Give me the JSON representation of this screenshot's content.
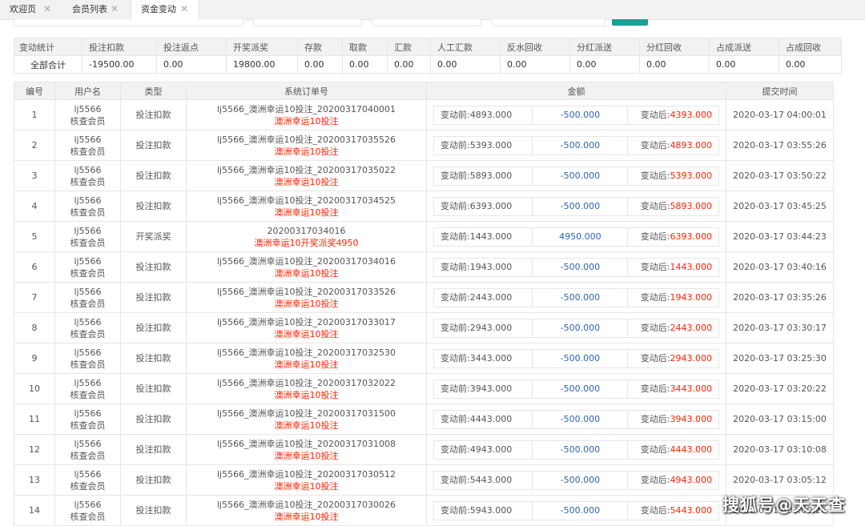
{
  "tabs": [
    {
      "label": "欢迎页",
      "active": false
    },
    {
      "label": "会员列表",
      "active": false
    },
    {
      "label": "资金变动",
      "active": true
    }
  ],
  "stats": {
    "headers": [
      "变动统计",
      "投注扣款",
      "投注返点",
      "开奖派奖",
      "存款",
      "取款",
      "汇款",
      "人工汇款",
      "反水回收",
      "分红派送",
      "分红回收",
      "占成派送",
      "占成回收"
    ],
    "values": [
      "全部合计",
      "-19500.00",
      "0.00",
      "19800.00",
      "0.00",
      "0.00",
      "0.00",
      "0.00",
      "0.00",
      "0.00",
      "0.00",
      "0.00",
      "0.00"
    ]
  },
  "table": {
    "headers": {
      "index": "编号",
      "username": "用户名",
      "type": "类型",
      "order": "系统订单号",
      "amount": "金额",
      "time": "提交时间"
    },
    "before_label": "变动前:",
    "after_label": "变动后:",
    "rows": [
      {
        "index": "1",
        "user": "lj5566",
        "role": "核查会员",
        "type": "投注扣款",
        "order": "lj5566_澳洲幸运10投注_20200317040001",
        "desc": "澳洲幸运10投注",
        "before": "4893.000",
        "change": "-500.000",
        "after": "4393.000",
        "time": "2020-03-17 04:00:01"
      },
      {
        "index": "2",
        "user": "lj5566",
        "role": "核查会员",
        "type": "投注扣款",
        "order": "lj5566_澳洲幸运10投注_20200317035526",
        "desc": "澳洲幸运10投注",
        "before": "5393.000",
        "change": "-500.000",
        "after": "4893.000",
        "time": "2020-03-17 03:55:26"
      },
      {
        "index": "3",
        "user": "lj5566",
        "role": "核查会员",
        "type": "投注扣款",
        "order": "lj5566_澳洲幸运10投注_20200317035022",
        "desc": "澳洲幸运10投注",
        "before": "5893.000",
        "change": "-500.000",
        "after": "5393.000",
        "time": "2020-03-17 03:50:22"
      },
      {
        "index": "4",
        "user": "lj5566",
        "role": "核查会员",
        "type": "投注扣款",
        "order": "lj5566_澳洲幸运10投注_20200317034525",
        "desc": "澳洲幸运10投注",
        "before": "6393.000",
        "change": "-500.000",
        "after": "5893.000",
        "time": "2020-03-17 03:45:25"
      },
      {
        "index": "5",
        "user": "lj5566",
        "role": "核查会员",
        "type": "开奖派奖",
        "order": "20200317034016",
        "desc": "澳洲幸运10开奖派奖4950",
        "before": "1443.000",
        "change": "4950.000",
        "after": "6393.000",
        "time": "2020-03-17 03:44:23"
      },
      {
        "index": "6",
        "user": "lj5566",
        "role": "核查会员",
        "type": "投注扣款",
        "order": "lj5566_澳洲幸运10投注_20200317034016",
        "desc": "澳洲幸运10投注",
        "before": "1943.000",
        "change": "-500.000",
        "after": "1443.000",
        "time": "2020-03-17 03:40:16"
      },
      {
        "index": "7",
        "user": "lj5566",
        "role": "核查会员",
        "type": "投注扣款",
        "order": "lj5566_澳洲幸运10投注_20200317033526",
        "desc": "澳洲幸运10投注",
        "before": "2443.000",
        "change": "-500.000",
        "after": "1943.000",
        "time": "2020-03-17 03:35:26"
      },
      {
        "index": "8",
        "user": "lj5566",
        "role": "核查会员",
        "type": "投注扣款",
        "order": "lj5566_澳洲幸运10投注_20200317033017",
        "desc": "澳洲幸运10投注",
        "before": "2943.000",
        "change": "-500.000",
        "after": "2443.000",
        "time": "2020-03-17 03:30:17"
      },
      {
        "index": "9",
        "user": "lj5566",
        "role": "核查会员",
        "type": "投注扣款",
        "order": "lj5566_澳洲幸运10投注_20200317032530",
        "desc": "澳洲幸运10投注",
        "before": "3443.000",
        "change": "-500.000",
        "after": "2943.000",
        "time": "2020-03-17 03:25:30"
      },
      {
        "index": "10",
        "user": "lj5566",
        "role": "核查会员",
        "type": "投注扣款",
        "order": "lj5566_澳洲幸运10投注_20200317032022",
        "desc": "澳洲幸运10投注",
        "before": "3943.000",
        "change": "-500.000",
        "after": "3443.000",
        "time": "2020-03-17 03:20:22"
      },
      {
        "index": "11",
        "user": "lj5566",
        "role": "核查会员",
        "type": "投注扣款",
        "order": "lj5566_澳洲幸运10投注_20200317031500",
        "desc": "澳洲幸运10投注",
        "before": "4443.000",
        "change": "-500.000",
        "after": "3943.000",
        "time": "2020-03-17 03:15:00"
      },
      {
        "index": "12",
        "user": "lj5566",
        "role": "核查会员",
        "type": "投注扣款",
        "order": "lj5566_澳洲幸运10投注_20200317031008",
        "desc": "澳洲幸运10投注",
        "before": "4943.000",
        "change": "-500.000",
        "after": "4443.000",
        "time": "2020-03-17 03:10:08"
      },
      {
        "index": "13",
        "user": "lj5566",
        "role": "核查会员",
        "type": "投注扣款",
        "order": "lj5566_澳洲幸运10投注_20200317030512",
        "desc": "澳洲幸运10投注",
        "before": "5443.000",
        "change": "-500.000",
        "after": "4943.000",
        "time": "2020-03-17 03:05:12"
      },
      {
        "index": "14",
        "user": "lj5566",
        "role": "核查会员",
        "type": "投注扣款",
        "order": "lj5566_澳洲幸运10投注_20200317030026",
        "desc": "澳洲幸运10投注",
        "before": "5943.000",
        "change": "-500.000",
        "after": "5443.000",
        "time": "2020-03-17 03:00:26"
      }
    ]
  },
  "colors": {
    "negative": "#2a64b8",
    "positive": "#2a64b8",
    "highlight": "#ff2200",
    "accent": "#1aa094"
  },
  "watermark": "搜狐号@天天查"
}
